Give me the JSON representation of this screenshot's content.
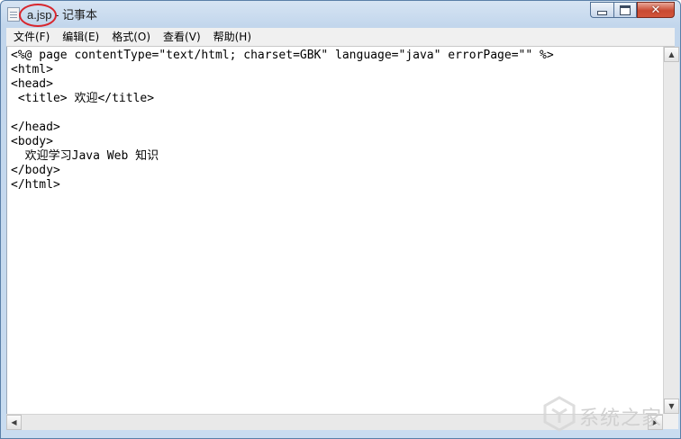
{
  "window": {
    "filename": "a.jsp",
    "app_suffix": " - 记事本",
    "close_glyph": "✕"
  },
  "menu": [
    {
      "label": "文件(F)"
    },
    {
      "label": "编辑(E)"
    },
    {
      "label": "格式(O)"
    },
    {
      "label": "查看(V)"
    },
    {
      "label": "帮助(H)"
    }
  ],
  "editor": {
    "content": "<%@ page contentType=\"text/html; charset=GBK\" language=\"java\" errorPage=\"\" %>\n<html>\n<head>\n <title> 欢迎</title>\n\n</head>\n<body>\n  欢迎学习Java Web 知识\n</body>\n</html>"
  },
  "scrollbar": {
    "up": "▲",
    "down": "▼",
    "left": "◀",
    "right": "▶"
  },
  "watermark": {
    "text": "系统之家"
  },
  "colors": {
    "title_bar": "#c8daee",
    "annotation_ring": "#d8262d",
    "close_button": "#c94a32"
  }
}
